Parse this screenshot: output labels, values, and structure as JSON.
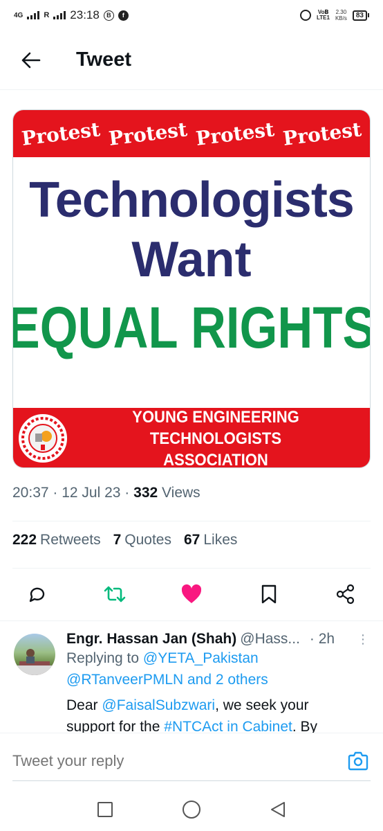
{
  "status_bar": {
    "network": "4G",
    "roaming": "R",
    "time": "23:18",
    "notif_icon_1": "B",
    "volte": "VoB LTE1",
    "speed_value": "2.30",
    "speed_unit": "KB/s",
    "battery": "83"
  },
  "header": {
    "title": "Tweet"
  },
  "image": {
    "banner_words": [
      "Protest",
      "Protest",
      "Protest",
      "Protest"
    ],
    "line1": "Technologists",
    "line2": "Want",
    "line3": "EQUAL RIGHTS",
    "assoc_line1": "YOUNG ENGINEERING TECHNOLOGISTS",
    "assoc_line2": "ASSOCIATION",
    "colors": {
      "red": "#e4141d",
      "navy": "#2b2d6e",
      "green": "#11964b"
    }
  },
  "meta": {
    "time": "20:37",
    "date": "12 Jul 23",
    "views_count": "332",
    "views_label": "Views"
  },
  "stats": {
    "retweets_count": "222",
    "retweets_label": "Retweets",
    "quotes_count": "7",
    "quotes_label": "Quotes",
    "likes_count": "67",
    "likes_label": "Likes"
  },
  "actions": [
    {
      "name": "reply-icon"
    },
    {
      "name": "retweet-icon",
      "color": "#00ba7c"
    },
    {
      "name": "like-icon",
      "color": "#f91880"
    },
    {
      "name": "bookmark-icon"
    },
    {
      "name": "share-icon"
    }
  ],
  "reply": {
    "name": "Engr. Hassan Jan (Shah)",
    "handle": "@Hass...",
    "time": "· 2h",
    "replying_prefix": "Replying to",
    "replying_handle": "@YETA_Pakistan",
    "replying_line2": "@RTanveerPMLN and 2 others",
    "text_pre": "Dear",
    "text_mention": "@FaisalSubzwari",
    "text_mid": ", we seek your",
    "text_line2_pre": "support for the",
    "text_hashtag": "#NTCAct in Cabinet",
    "text_line2_post": ". By"
  },
  "compose": {
    "placeholder": "Tweet your reply"
  }
}
